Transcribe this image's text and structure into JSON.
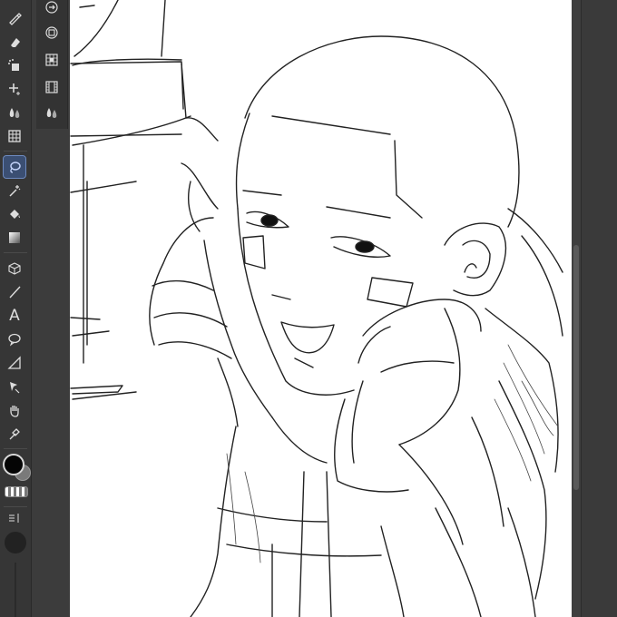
{
  "toolbar": {
    "tools": [
      {
        "icon": "pen-icon",
        "active": false
      },
      {
        "icon": "eraser-icon",
        "active": false
      },
      {
        "icon": "airbrush-icon",
        "active": false
      },
      {
        "icon": "decoration-icon",
        "active": false
      },
      {
        "icon": "blend-icon",
        "active": false
      },
      {
        "icon": "grid-icon",
        "active": false
      },
      {
        "icon": "lasso-selection-icon",
        "active": true
      },
      {
        "icon": "magic-wand-icon",
        "active": false
      },
      {
        "icon": "fill-bucket-icon",
        "active": false
      },
      {
        "icon": "gradient-icon",
        "active": false
      },
      {
        "icon": "3d-object-icon",
        "active": false
      },
      {
        "icon": "line-icon",
        "active": false
      },
      {
        "icon": "text-icon",
        "active": false
      },
      {
        "icon": "balloon-icon",
        "active": false
      },
      {
        "icon": "ruler-icon",
        "active": false
      },
      {
        "icon": "operation-icon",
        "active": false
      },
      {
        "icon": "hand-icon",
        "active": false
      },
      {
        "icon": "eyedropper-icon",
        "active": false
      }
    ],
    "text_tool_label": "A",
    "main_color": "#050505",
    "sub_color": "#7a7a7a",
    "accent": "#3b4f73"
  },
  "subpanel": {
    "icons": [
      "sub-tool-arrow-icon",
      "sub-tool-layer-icon",
      "sub-tool-grid-icon",
      "sub-tool-film-icon",
      "sub-tool-drops-icon"
    ]
  }
}
